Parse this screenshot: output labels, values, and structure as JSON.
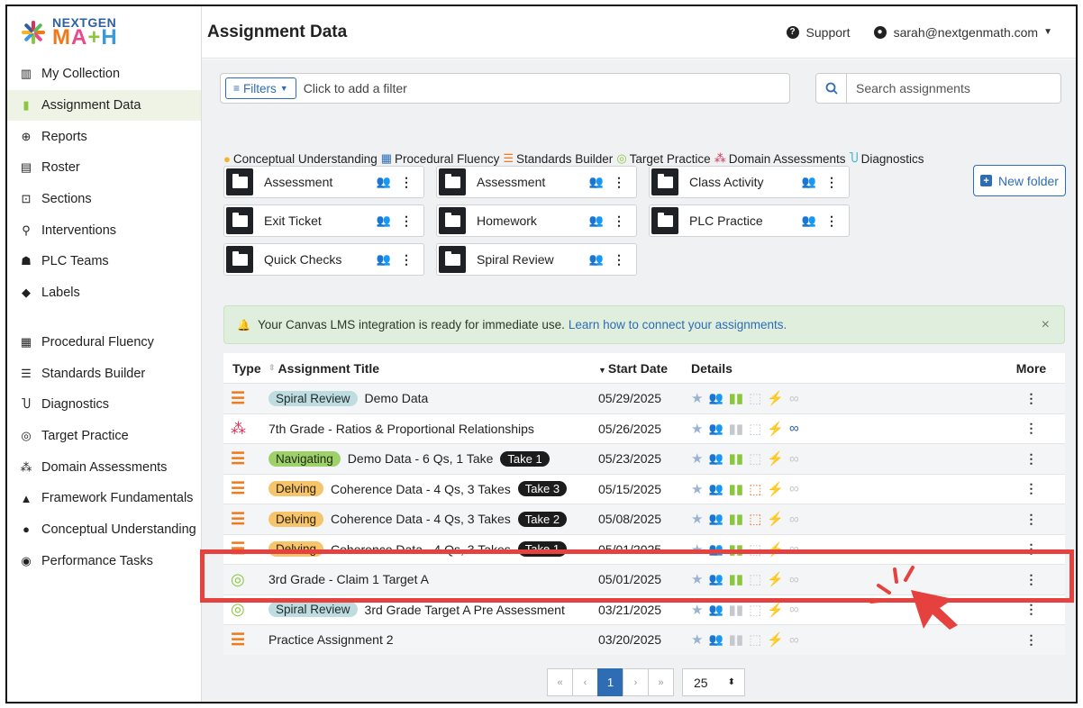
{
  "app": {
    "logo_top": "NEXTGEN",
    "logo_bottom": [
      "M",
      "A",
      "+",
      "H"
    ],
    "page_title": "Assignment Data",
    "support_label": "Support",
    "user_email": "sarah@nextgenmath.com"
  },
  "sidebar": {
    "primary": [
      {
        "label": "My Collection",
        "icon": "books-icon"
      },
      {
        "label": "Assignment Data",
        "icon": "bar-chart-icon",
        "active": true
      },
      {
        "label": "Reports",
        "icon": "magnifier-icon"
      },
      {
        "label": "Roster",
        "icon": "roster-icon"
      },
      {
        "label": "Sections",
        "icon": "sections-icon"
      },
      {
        "label": "Interventions",
        "icon": "interventions-icon"
      },
      {
        "label": "PLC Teams",
        "icon": "team-icon"
      },
      {
        "label": "Labels",
        "icon": "tag-icon"
      }
    ],
    "secondary": [
      {
        "label": "Procedural Fluency",
        "icon": "grid-icon"
      },
      {
        "label": "Standards Builder",
        "icon": "list-icon"
      },
      {
        "label": "Diagnostics",
        "icon": "stethoscope-icon"
      },
      {
        "label": "Target Practice",
        "icon": "target-icon"
      },
      {
        "label": "Domain Assessments",
        "icon": "cubes-icon"
      },
      {
        "label": "Framework Fundamentals",
        "icon": "shapes-icon"
      },
      {
        "label": "Conceptual Understanding",
        "icon": "bulb-icon"
      },
      {
        "label": "Performance Tasks",
        "icon": "globe-icon"
      }
    ]
  },
  "filters": {
    "button_label": "Filters",
    "placeholder": "Click to add a filter"
  },
  "search": {
    "placeholder": "Search assignments"
  },
  "legend": [
    {
      "label": "Conceptual Understanding",
      "icon": "bulb-icon",
      "color": "#f3b521"
    },
    {
      "label": "Procedural Fluency",
      "icon": "grid-icon",
      "color": "#2e6db4"
    },
    {
      "label": "Standards Builder",
      "icon": "list-icon",
      "color": "#f07a1a"
    },
    {
      "label": "Target Practice",
      "icon": "target-icon",
      "color": "#8cc63f"
    },
    {
      "label": "Domain Assessments",
      "icon": "cubes-icon",
      "color": "#d8305a"
    },
    {
      "label": "Diagnostics",
      "icon": "stethoscope-icon",
      "color": "#3bb0d9"
    }
  ],
  "folders": [
    {
      "label": "Assessment",
      "shared": true
    },
    {
      "label": "Assessment",
      "shared": false
    },
    {
      "label": "Class Activity",
      "shared": false
    },
    {
      "label": "Exit Ticket",
      "shared": false
    },
    {
      "label": "Homework",
      "shared": false
    },
    {
      "label": "PLC Practice",
      "shared": true
    },
    {
      "label": "Quick Checks",
      "shared": false
    },
    {
      "label": "Spiral Review",
      "shared": false
    }
  ],
  "new_folder_label": "New folder",
  "alert": {
    "text": "Your Canvas LMS integration is ready for immediate use.",
    "link": "Learn how to connect your assignments.",
    "close": "×"
  },
  "table": {
    "headers": {
      "type": "Type",
      "title": "Assignment Title",
      "date": "Start Date",
      "details": "Details",
      "more": "More"
    },
    "rows": [
      {
        "type": "standards-builder",
        "tag": "Spiral Review",
        "tag_style": "spiral",
        "title": "Demo Data",
        "take": "",
        "date": "05/29/2025",
        "people": "off",
        "bar": true,
        "sq": false,
        "bolt": true,
        "link": false
      },
      {
        "type": "domain-assessment",
        "tag": "",
        "tag_style": "",
        "title": "7th Grade - Ratios & Proportional Relationships",
        "take": "",
        "date": "05/26/2025",
        "people": "off",
        "bar": false,
        "sq": false,
        "bolt": true,
        "link": true
      },
      {
        "type": "standards-builder",
        "tag": "Navigating",
        "tag_style": "nav",
        "title": "Demo Data - 6 Qs, 1 Take",
        "take": "Take 1",
        "date": "05/23/2025",
        "people": "off",
        "bar": true,
        "sq": false,
        "bolt": true,
        "link": false
      },
      {
        "type": "standards-builder",
        "tag": "Delving",
        "tag_style": "delve",
        "title": "Coherence Data - 4 Qs, 3 Takes",
        "take": "Take 3",
        "date": "05/15/2025",
        "people": "off",
        "bar": true,
        "sq": true,
        "bolt": true,
        "link": false
      },
      {
        "type": "standards-builder",
        "tag": "Delving",
        "tag_style": "delve",
        "title": "Coherence Data - 4 Qs, 3 Takes",
        "take": "Take 2",
        "date": "05/08/2025",
        "people": "off",
        "bar": true,
        "sq": true,
        "bolt": true,
        "link": false
      },
      {
        "type": "standards-builder",
        "tag": "Delving",
        "tag_style": "delve",
        "title": "Coherence Data - 4 Qs, 3 Takes",
        "take": "Take 1",
        "date": "05/01/2025",
        "people": "off",
        "bar": true,
        "sq": false,
        "bolt": true,
        "link": false
      },
      {
        "type": "target-practice",
        "tag": "",
        "tag_style": "",
        "title": "3rd Grade - Claim 1 Target A",
        "take": "",
        "date": "05/01/2025",
        "people": "off",
        "bar": true,
        "sq": false,
        "bolt": true,
        "link": false
      },
      {
        "type": "target-practice",
        "tag": "Spiral Review",
        "tag_style": "spiral",
        "title": "3rd Grade Target A Pre Assessment",
        "take": "",
        "date": "03/21/2025",
        "people": "red",
        "bar": false,
        "sq": false,
        "bolt": true,
        "link": false
      },
      {
        "type": "standards-builder",
        "tag": "",
        "tag_style": "",
        "title": "Practice Assignment 2",
        "take": "",
        "date": "03/20/2025",
        "people": "green",
        "bar": false,
        "sq": false,
        "bolt": true,
        "link": false
      }
    ],
    "more_glyph": "⋮"
  },
  "pagination": {
    "first": "«",
    "prev": "‹",
    "current": "1",
    "next": "›",
    "last": "»",
    "page_size": "25"
  },
  "colors": {
    "accent": "#2e6db4",
    "highlight": "#e5423f"
  }
}
